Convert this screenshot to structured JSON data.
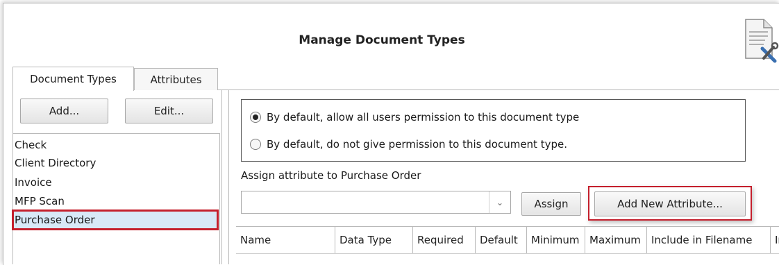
{
  "window": {
    "title": "Manage Document Types",
    "icon": "document-tools-icon"
  },
  "tabs": [
    {
      "label": "Document Types",
      "active": true
    },
    {
      "label": "Attributes",
      "active": false
    }
  ],
  "left_panel": {
    "add_label": "Add...",
    "edit_label": "Edit...",
    "items": [
      {
        "label": "Check"
      },
      {
        "label": "Client Directory"
      },
      {
        "label": "Invoice"
      },
      {
        "label": "MFP Scan"
      },
      {
        "label": "Purchase Order",
        "selected": true
      }
    ]
  },
  "permissions": {
    "options": [
      {
        "label": "By default, allow all users permission to this document type",
        "checked": true
      },
      {
        "label": "By default, do not give permission to this document type.",
        "checked": false
      }
    ]
  },
  "assign": {
    "label": "Assign attribute to Purchase Order",
    "select_value": "",
    "assign_label": "Assign",
    "add_new_label": "Add New Attribute..."
  },
  "grid": {
    "columns": [
      "Name",
      "Data Type",
      "Required",
      "Default",
      "Minimum",
      "Maximum",
      "Include in Filename",
      "Ir"
    ]
  },
  "colors": {
    "highlight": "#c41f2c",
    "selection": "#d8e9f7"
  }
}
